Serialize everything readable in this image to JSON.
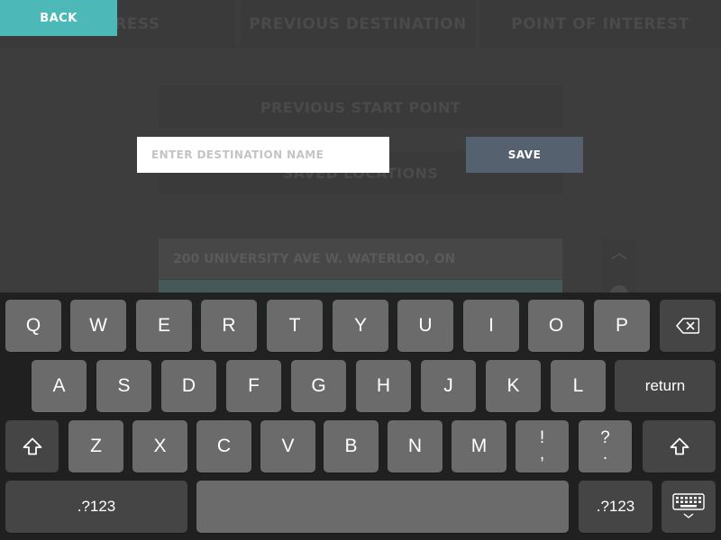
{
  "background": {
    "tabs": [
      "ADDRESS",
      "PREVIOUS DESTINATION",
      "POINT OF INTEREST"
    ],
    "options": {
      "previous_start": "PREVIOUS START POINT",
      "saved_locations": "SAVED LOCATIONS"
    },
    "list_items": [
      "200 UNIVERSITY AVE W. WATERLOO, ON",
      "",
      "",
      ""
    ]
  },
  "back_button": {
    "label": "BACK"
  },
  "destination_input": {
    "placeholder": "ENTER DESTINATION NAME",
    "value": ""
  },
  "save_button": {
    "label": "SAVE"
  },
  "keyboard": {
    "row1": [
      "Q",
      "W",
      "E",
      "R",
      "T",
      "Y",
      "U",
      "I",
      "O",
      "P"
    ],
    "row2": [
      "A",
      "S",
      "D",
      "F",
      "G",
      "H",
      "J",
      "K",
      "L"
    ],
    "row3": [
      "Z",
      "X",
      "C",
      "V",
      "B",
      "N",
      "M"
    ],
    "punct1_top": "!",
    "punct1_bottom": ",",
    "punct2_top": "?",
    "punct2_bottom": ".",
    "return_label": "return",
    "numbers_label": ".?123",
    "icons": {
      "delete": "backspace-icon",
      "shift": "shift-icon",
      "dismiss": "keyboard-dismiss-icon"
    }
  },
  "colors": {
    "accent": "#4cb8b8",
    "save": "#566170",
    "key": "#6b6b6b",
    "key_dark": "#454545"
  }
}
